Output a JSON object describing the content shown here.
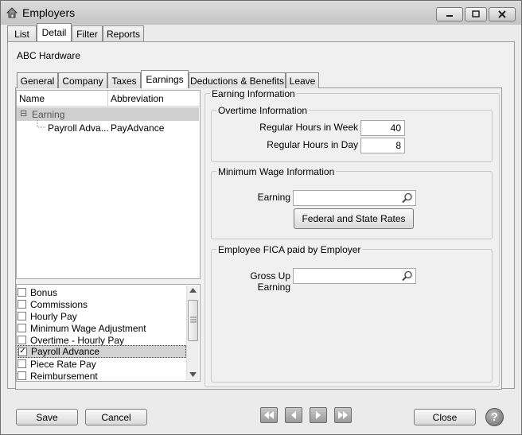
{
  "window": {
    "title": "Employers"
  },
  "top_tabs": [
    {
      "label": "List"
    },
    {
      "label": "Detail"
    },
    {
      "label": "Filter"
    },
    {
      "label": "Reports"
    }
  ],
  "company": "ABC Hardware",
  "inner_tabs": [
    {
      "label": "General"
    },
    {
      "label": "Company"
    },
    {
      "label": "Taxes"
    },
    {
      "label": "Earnings"
    },
    {
      "label": "Deductions & Benefits"
    },
    {
      "label": "Leave"
    }
  ],
  "tree": {
    "col_name": "Name",
    "col_abbrev": "Abbreviation",
    "group_label": "Earning",
    "group_toggle": "⊟",
    "items": [
      {
        "name": "Payroll Adva...",
        "abbrev": "PayAdvance"
      }
    ]
  },
  "checklist": [
    {
      "label": "Bonus",
      "checked": false
    },
    {
      "label": "Commissions",
      "checked": false
    },
    {
      "label": "Hourly Pay",
      "checked": false
    },
    {
      "label": "Minimum Wage Adjustment",
      "checked": false
    },
    {
      "label": "Overtime - Hourly Pay",
      "checked": false
    },
    {
      "label": "Payroll Advance",
      "checked": true,
      "mark": "✓"
    },
    {
      "label": "Piece Rate Pay",
      "checked": false
    },
    {
      "label": "Reimbursement",
      "checked": false
    }
  ],
  "earning_info": {
    "legend": "Earning Information",
    "overtime": {
      "legend": "Overtime Information",
      "hours_week_label": "Regular Hours in Week",
      "hours_week_value": "40",
      "hours_day_label": "Regular Hours in Day",
      "hours_day_value": "8"
    },
    "min_wage": {
      "legend": "Minimum Wage Information",
      "earning_label": "Earning",
      "earning_value": "",
      "rates_button": "Federal and State Rates"
    },
    "fica": {
      "legend": "Employee FICA paid by Employer",
      "gross_up_label": "Gross Up Earning",
      "gross_up_value": ""
    }
  },
  "footer": {
    "save": "Save",
    "cancel": "Cancel",
    "close": "Close",
    "help": "?"
  },
  "icons": {
    "search": "search-icon",
    "first": "first-record-icon",
    "prev": "previous-record-icon",
    "next": "next-record-icon",
    "last": "last-record-icon"
  }
}
